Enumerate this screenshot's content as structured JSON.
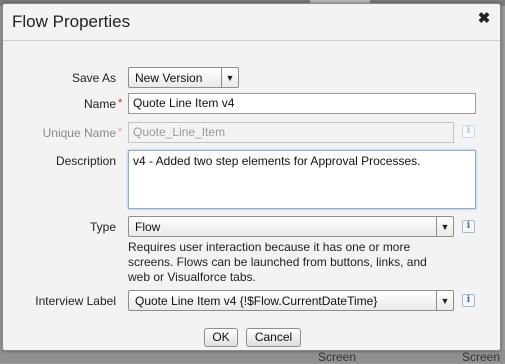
{
  "background": {
    "bottom_left_word": "Screen",
    "bottom_right_word": "Screen"
  },
  "dialog": {
    "title": "Flow Properties",
    "close_symbol": "✖"
  },
  "fields": {
    "save_as": {
      "label": "Save As",
      "value": "New Version"
    },
    "name": {
      "label": "Name",
      "value": "Quote Line Item v4",
      "required": "*"
    },
    "unique_name": {
      "label": "Unique Name",
      "value": "Quote_Line_Item",
      "required": "*"
    },
    "description": {
      "label": "Description",
      "value": "v4 - Added two step elements for Approval Processes."
    },
    "type": {
      "label": "Type",
      "value": "Flow",
      "help": "Requires user interaction because it has one or more screens. Flows can be launched from buttons, links, and web or Visualforce tabs."
    },
    "interview_label": {
      "label": "Interview Label",
      "value": "Quote Line Item v4 {!$Flow.CurrentDateTime}"
    }
  },
  "icons": {
    "info": "i",
    "dropdown": "▼"
  },
  "buttons": {
    "ok": "OK",
    "cancel": "Cancel"
  }
}
